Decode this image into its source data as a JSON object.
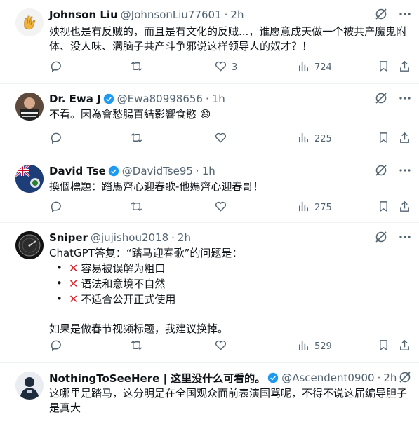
{
  "replies": [
    {
      "name": "Johnson Liu",
      "handle": "@JohnsonLiu77601",
      "time": "2h",
      "verified": false,
      "text": "殃视也是有反贼的，而且是有文化的反贼...，谁愿意成天做一个被共产魔鬼附体、没人味、满脑子共产斗争邪说这样领导人的奴才？！",
      "replies_count": "",
      "retweets": "",
      "likes": "3",
      "views": "724"
    },
    {
      "name": "Dr. Ewa J",
      "handle": "@Ewa80998656",
      "time": "1h",
      "verified": true,
      "text": "不看。因為會愁腸百結影響食慾 😄",
      "replies_count": "",
      "retweets": "",
      "likes": "",
      "views": "225"
    },
    {
      "name": "David Tse",
      "handle": "@DavidTse95",
      "time": "1h",
      "verified": true,
      "text": "換個標題：踏馬齊心迎春歌-他媽齊心迎春哥！",
      "replies_count": "",
      "retweets": "",
      "likes": "",
      "views": "275"
    },
    {
      "name": "Sniper",
      "handle": "@jujishou2018",
      "time": "2h",
      "verified": false,
      "text_intro": "ChatGPT答复：“踏马迎春歌”的问题是：",
      "bullets": [
        "容易被误解为粗口",
        "语法和意境不自然",
        "不适合公开正式使用"
      ],
      "text_outro": "如果是做春节视频标题，我建议换掉。",
      "replies_count": "",
      "retweets": "",
      "likes": "",
      "views": "529"
    },
    {
      "name": "NothingToSeeHere | 这里没什么可看的。",
      "handle": "@Ascendent0900",
      "time": "2h",
      "verified": true,
      "text": "这哪里是踏马，这分明是在全国观众面前表演国骂呢，不得不说这届编导胆子是真大"
    }
  ],
  "icons": {
    "reply": "reply-icon",
    "retweet": "retweet-icon",
    "like": "heart-icon",
    "views": "views-icon",
    "bookmark": "bookmark-icon",
    "share": "share-icon",
    "grok": "grok-icon",
    "more": "more-icon"
  },
  "colors": {
    "verified": "#1d9bf0",
    "text": "#0f1419",
    "muted": "#536471",
    "x_mark": "#d9262c"
  }
}
